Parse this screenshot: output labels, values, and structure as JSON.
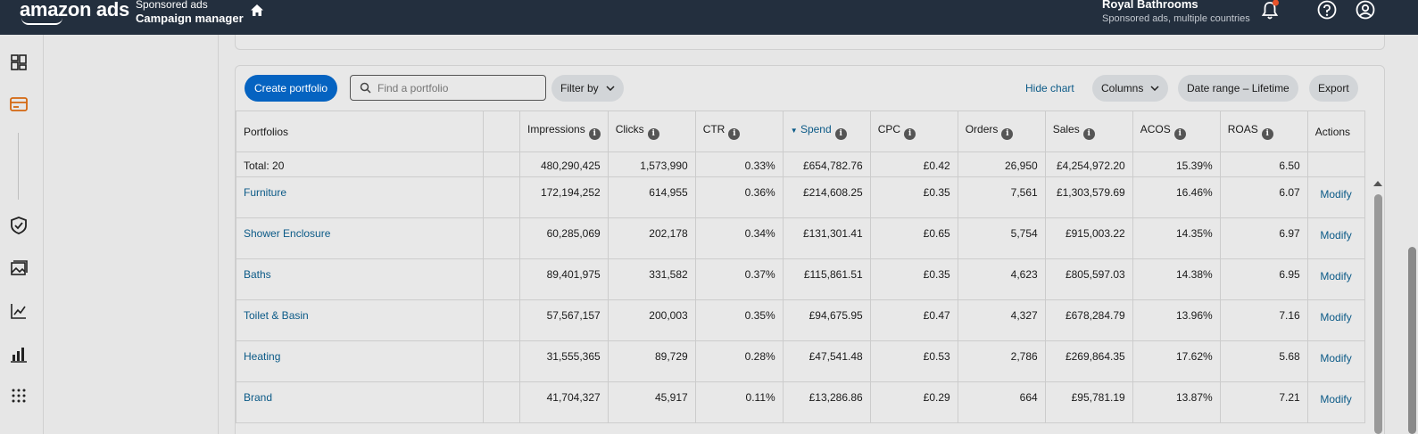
{
  "header": {
    "logo_text": "amazon ads",
    "context_line1": "Sponsored ads",
    "context_line2": "Campaign manager",
    "account_name": "Royal Bathrooms",
    "account_sub": "Sponsored ads, multiple countries"
  },
  "toolbar": {
    "create_label": "Create portfolio",
    "search_placeholder": "Find a portfolio",
    "filter_label": "Filter by",
    "hide_chart_label": "Hide chart",
    "columns_label": "Columns",
    "date_range_label": "Date range – Lifetime",
    "export_label": "Export"
  },
  "table": {
    "headers": {
      "portfolios": "Portfolios",
      "impressions": "Impressions",
      "clicks": "Clicks",
      "ctr": "CTR",
      "spend": "Spend",
      "cpc": "CPC",
      "orders": "Orders",
      "sales": "Sales",
      "acos": "ACOS",
      "roas": "ROAS",
      "actions": "Actions"
    },
    "total": {
      "label": "Total: 20",
      "impressions": "480,290,425",
      "clicks": "1,573,990",
      "ctr": "0.33%",
      "spend": "£654,782.76",
      "cpc": "£0.42",
      "orders": "26,950",
      "sales": "£4,254,972.20",
      "acos": "15.39%",
      "roas": "6.50"
    },
    "rows": [
      {
        "name": "Furniture",
        "impressions": "172,194,252",
        "clicks": "614,955",
        "ctr": "0.36%",
        "spend": "£214,608.25",
        "cpc": "£0.35",
        "orders": "7,561",
        "sales": "£1,303,579.69",
        "acos": "16.46%",
        "roas": "6.07",
        "action": "Modify"
      },
      {
        "name": "Shower Enclosure",
        "impressions": "60,285,069",
        "clicks": "202,178",
        "ctr": "0.34%",
        "spend": "£131,301.41",
        "cpc": "£0.65",
        "orders": "5,754",
        "sales": "£915,003.22",
        "acos": "14.35%",
        "roas": "6.97",
        "action": "Modify"
      },
      {
        "name": "Baths",
        "impressions": "89,401,975",
        "clicks": "331,582",
        "ctr": "0.37%",
        "spend": "£115,861.51",
        "cpc": "£0.35",
        "orders": "4,623",
        "sales": "£805,597.03",
        "acos": "14.38%",
        "roas": "6.95",
        "action": "Modify"
      },
      {
        "name": "Toilet & Basin",
        "impressions": "57,567,157",
        "clicks": "200,003",
        "ctr": "0.35%",
        "spend": "£94,675.95",
        "cpc": "£0.47",
        "orders": "4,327",
        "sales": "£678,284.79",
        "acos": "13.96%",
        "roas": "7.16",
        "action": "Modify"
      },
      {
        "name": "Heating",
        "impressions": "31,555,365",
        "clicks": "89,729",
        "ctr": "0.28%",
        "spend": "£47,541.48",
        "cpc": "£0.53",
        "orders": "2,786",
        "sales": "£269,864.35",
        "acos": "17.62%",
        "roas": "5.68",
        "action": "Modify"
      },
      {
        "name": "Brand",
        "impressions": "41,704,327",
        "clicks": "45,917",
        "ctr": "0.11%",
        "spend": "£13,286.86",
        "cpc": "£0.29",
        "orders": "664",
        "sales": "£95,781.19",
        "acos": "13.87%",
        "roas": "7.21",
        "action": "Modify"
      }
    ]
  },
  "colors": {
    "topbar": "#232f3e",
    "primary": "#0563c1",
    "link": "#0b5a87"
  }
}
